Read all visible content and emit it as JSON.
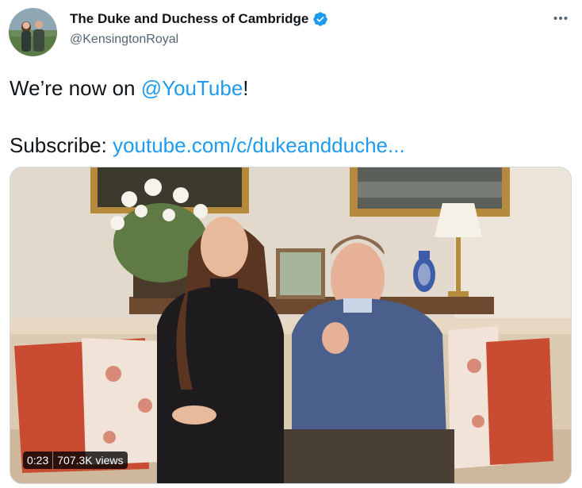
{
  "author": {
    "display_name": "The Duke and Duchess of Cambridge",
    "handle": "@KensingtonRoyal",
    "avatar_icon": "profile-photo",
    "verified_icon": "verified-badge-icon",
    "verified_color": "#1d9bf0"
  },
  "more_icon": "more-options-icon",
  "tweet": {
    "text_part1": "We’re now on ",
    "mention": "@YouTube",
    "text_part2": "!",
    "subscribe_label": "Subscribe: ",
    "link": "youtube.com/c/dukeandduche..."
  },
  "video": {
    "duration": "0:23",
    "views": "707.3K views"
  },
  "colors": {
    "link": "#1d9bf0",
    "text": "#0f1419",
    "secondary": "#536471",
    "border": "#cfd9de"
  }
}
